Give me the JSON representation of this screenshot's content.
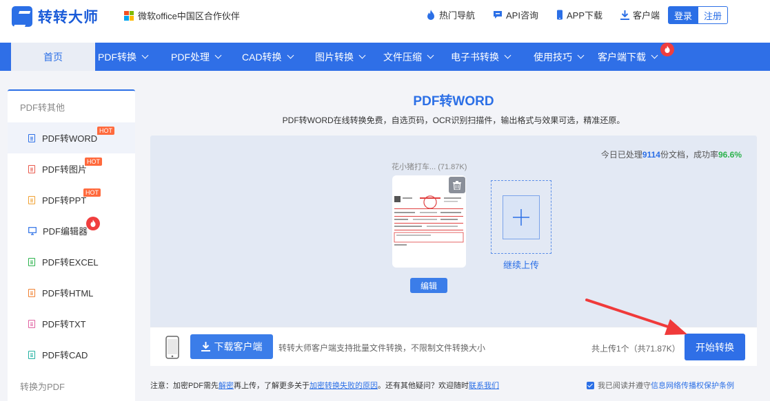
{
  "header": {
    "brand": "转转大师",
    "partner": "微软office中国区合作伙伴",
    "links": [
      {
        "label": "热门导航",
        "icon": "fire-icon"
      },
      {
        "label": "API咨询",
        "icon": "chat-icon"
      },
      {
        "label": "APP下载",
        "icon": "phone-icon"
      },
      {
        "label": "客户端",
        "icon": "download-icon"
      }
    ],
    "login": "登录",
    "register": "注册"
  },
  "nav": {
    "home": "首页",
    "items": [
      "PDF转换",
      "PDF处理",
      "CAD转换",
      "图片转换",
      "文件压缩",
      "电子书转换",
      "使用技巧",
      "客户端下载"
    ]
  },
  "sidebar": {
    "group1": "PDF转其他",
    "items": [
      {
        "label": "PDF转WORD",
        "badge": "HOT",
        "color": "#2b6fe6"
      },
      {
        "label": "PDF转图片",
        "badge": "HOT",
        "color": "#e8574a"
      },
      {
        "label": "PDF转PPT",
        "badge": "HOT",
        "color": "#f0a030"
      },
      {
        "label": "PDF编辑器",
        "badge": "fire",
        "color": "#2b6fe6"
      },
      {
        "label": "PDF转EXCEL",
        "badge": "",
        "color": "#2bb24c"
      },
      {
        "label": "PDF转HTML",
        "badge": "",
        "color": "#f08030"
      },
      {
        "label": "PDF转TXT",
        "badge": "",
        "color": "#e060a0"
      },
      {
        "label": "PDF转CAD",
        "badge": "",
        "color": "#20b0a0"
      }
    ],
    "group2": "转换为PDF"
  },
  "main": {
    "title": "PDF转WORD",
    "subtitle": "PDF转WORD在线转换免费，自选页码，OCR识别扫描件，输出格式与效果可选，精准还原。",
    "stats_prefix": "今日已处理",
    "stats_count": "9114",
    "stats_mid": "份文档，成功率",
    "stats_rate": "96.6%",
    "file_name": "花小猪打车... (71.87K)",
    "edit": "编辑",
    "continue_upload": "继续上传"
  },
  "bottom": {
    "download_client": "下载客户端",
    "download_desc": "转转大师客户端支持批量文件转换，不限制文件转换大小",
    "upload_count": "共上传1个（共71.87K）",
    "start": "开始转换"
  },
  "notice": {
    "p1": "注意：加密PDF需先",
    "link1": "解密",
    "p2": "再上传，了解更多关于",
    "link2": "加密转换失败的原因",
    "p3": "。还有其他疑问？欢迎随时",
    "link3": "联系我们"
  },
  "agree": {
    "prefix": "我已阅读并遵守",
    "link": "信息网络传播权保护条例"
  }
}
